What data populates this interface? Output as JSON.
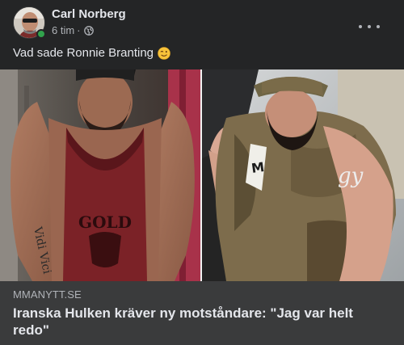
{
  "post": {
    "author": "Carl Norberg",
    "time": "6 tim",
    "separator": "·",
    "audience_icon": "globe-icon",
    "text": "Vad sade Ronnie Branting",
    "emoji": "winking-face-emoji",
    "more_icon": "more-horizontal-icon"
  },
  "media": {
    "left_icon": "bodybuilder-photo",
    "right_icon": "man-in-car-photo",
    "shirt_text_left": "GOLD'S GYM",
    "shirt_text_right": "gy",
    "tattoo_text": "Vidi Vici"
  },
  "link": {
    "domain": "MMANYTT.SE",
    "title": "Iranska Hulken kräver ny motståndare: \"Jag var helt redo\""
  },
  "colors": {
    "card_bg": "#242526",
    "link_bg": "#3a3b3c",
    "text_primary": "#e4e6eb",
    "text_secondary": "#b0b3b8",
    "online": "#31a24c"
  }
}
